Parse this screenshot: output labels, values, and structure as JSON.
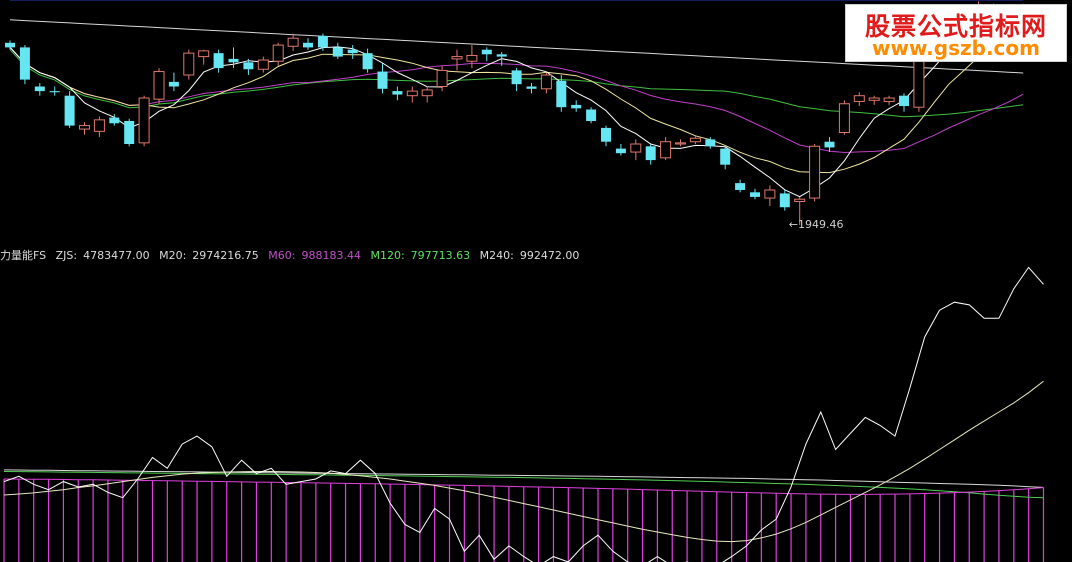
{
  "watermark": {
    "line1": "股票公式指标网",
    "line2": "www.gszb.com"
  },
  "colors": {
    "background": "#000000",
    "candle_up": "#e0786a",
    "candle_down": "#66e6f2",
    "ma_short": "#ffffff",
    "ma_mid": "#f0e6a0",
    "ma_purple": "#c040c8",
    "ma_green": "#40c040",
    "ma_long": "#d8d8d8",
    "ma_blue": "#2a3ab8",
    "fs_line": "#ffffff",
    "m20": "#e8e8c0",
    "m60": "#e040e0",
    "m120": "#50d050",
    "m240": "#d8d8d8",
    "m60_label": "#c050c8",
    "m120_label": "#60e060",
    "annotation": "#d0d0d0"
  },
  "legend": {
    "name": "力量能FS",
    "zjs_label": "ZJS:",
    "zjs_value": "4783477.00",
    "m20_label": "M20:",
    "m20_value": "2974216.75",
    "m60_label": "M60:",
    "m60_value": "988183.44",
    "m120_label": "M120:",
    "m120_value": "797713.63",
    "m240_label": "M240:",
    "m240_value": "992472.00"
  },
  "chart_data": [
    {
      "type": "candlestick",
      "annotation": "←1949.46",
      "low_marker": {
        "index": 52,
        "value": 1949.46
      },
      "ylim": [
        1940,
        2140
      ],
      "candles": [
        [
          2108,
          2110,
          2102,
          2104
        ],
        [
          2104,
          2106,
          2072,
          2076
        ],
        [
          2070,
          2073,
          2062,
          2066
        ],
        [
          2066,
          2070,
          2062,
          2065
        ],
        [
          2062,
          2066,
          2034,
          2036
        ],
        [
          2033,
          2039,
          2028,
          2036
        ],
        [
          2031,
          2044,
          2026,
          2041
        ],
        [
          2043,
          2046,
          2036,
          2038
        ],
        [
          2040,
          2042,
          2018,
          2020
        ],
        [
          2021,
          2062,
          2018,
          2060
        ],
        [
          2059,
          2086,
          2055,
          2083
        ],
        [
          2074,
          2082,
          2066,
          2070
        ],
        [
          2080,
          2102,
          2076,
          2099
        ],
        [
          2096,
          2102,
          2089,
          2101
        ],
        [
          2099,
          2102,
          2082,
          2086
        ],
        [
          2094,
          2104,
          2086,
          2091
        ],
        [
          2091,
          2094,
          2080,
          2085
        ],
        [
          2085,
          2096,
          2082,
          2093
        ],
        [
          2092,
          2108,
          2088,
          2106
        ],
        [
          2105,
          2116,
          2101,
          2112
        ],
        [
          2108,
          2112,
          2102,
          2104
        ],
        [
          2114,
          2116,
          2101,
          2104
        ],
        [
          2104,
          2108,
          2094,
          2096
        ],
        [
          2102,
          2106,
          2094,
          2099
        ],
        [
          2099,
          2103,
          2082,
          2085
        ],
        [
          2083,
          2090,
          2064,
          2068
        ],
        [
          2066,
          2070,
          2058,
          2063
        ],
        [
          2062,
          2070,
          2056,
          2066
        ],
        [
          2062,
          2070,
          2056,
          2067
        ],
        [
          2070,
          2088,
          2066,
          2084
        ],
        [
          2094,
          2102,
          2084,
          2096
        ],
        [
          2092,
          2106,
          2086,
          2097
        ],
        [
          2102,
          2104,
          2092,
          2098
        ],
        [
          2098,
          2100,
          2088,
          2096
        ],
        [
          2084,
          2086,
          2066,
          2072
        ],
        [
          2070,
          2073,
          2064,
          2068
        ],
        [
          2068,
          2082,
          2064,
          2080
        ],
        [
          2075,
          2080,
          2048,
          2052
        ],
        [
          2054,
          2058,
          2048,
          2051
        ],
        [
          2050,
          2052,
          2038,
          2040
        ],
        [
          2034,
          2036,
          2018,
          2022
        ],
        [
          2016,
          2020,
          2010,
          2012
        ],
        [
          2013,
          2024,
          2006,
          2020
        ],
        [
          2018,
          2020,
          2002,
          2006
        ],
        [
          2008,
          2026,
          2006,
          2022
        ],
        [
          2020,
          2024,
          2018,
          2021
        ],
        [
          2022,
          2027,
          2020,
          2025
        ],
        [
          2024,
          2026,
          2016,
          2018
        ],
        [
          2016,
          2018,
          1998,
          2002
        ],
        [
          1986,
          1989,
          1978,
          1980
        ],
        [
          1978,
          1981,
          1972,
          1974
        ],
        [
          1973,
          1984,
          1966,
          1980
        ],
        [
          1977,
          1980,
          1962,
          1965
        ],
        [
          1970,
          1974,
          1949.46,
          1972
        ],
        [
          1973,
          2020,
          1970,
          2018
        ],
        [
          2022,
          2026,
          2013,
          2017
        ],
        [
          2030,
          2058,
          2028,
          2055
        ],
        [
          2057,
          2065,
          2053,
          2062
        ],
        [
          2058,
          2062,
          2054,
          2060
        ],
        [
          2057,
          2062,
          2054,
          2060
        ],
        [
          2062,
          2064,
          2048,
          2053
        ],
        [
          2052,
          2130,
          2048,
          2128
        ],
        [
          2128,
          2136,
          2124,
          2132
        ],
        [
          2132,
          2138,
          2128,
          2134
        ],
        [
          2134,
          2140,
          2130,
          2136
        ],
        [
          2136,
          2144,
          2132,
          2138
        ],
        [
          2138,
          2142,
          2126,
          2128
        ],
        [
          2128,
          2138,
          2124,
          2134
        ],
        [
          2134,
          2142,
          2132,
          2140
        ]
      ]
    },
    {
      "type": "line",
      "title": "力量能FS",
      "ylim": [
        -400000,
        5200000
      ],
      "series": [
        {
          "name": "ZJS",
          "values": [
            1100000,
            1200000,
            1050000,
            950000,
            1100000,
            1000000,
            1050000,
            900000,
            800000,
            1150000,
            1550000,
            1350000,
            1800000,
            1950000,
            1750000,
            1200000,
            1500000,
            1250000,
            1350000,
            1050000,
            1100000,
            1150000,
            1300000,
            1250000,
            1500000,
            1250000,
            700000,
            300000,
            150000,
            600000,
            400000,
            -200000,
            100000,
            -350000,
            -100000,
            -300000,
            -500000,
            -300000,
            -400000,
            -100000,
            100000,
            -200000,
            -400000,
            -600000,
            -300000,
            -500000,
            -400000,
            -600000,
            -500000,
            -300000,
            -100000,
            200000,
            400000,
            1000000,
            1800000,
            2400000,
            1700000,
            2000000,
            2300000,
            2150000,
            1950000,
            2850000,
            3800000,
            4300000,
            4450000,
            4400000,
            4150000,
            4150000,
            4700000,
            5100000,
            4783477
          ]
        },
        {
          "name": "M20",
          "values": [
            850000,
            870000,
            890000,
            920000,
            950000,
            990000,
            1020000,
            1060000,
            1100000,
            1140000,
            1180000,
            1210000,
            1240000,
            1260000,
            1270000,
            1280000,
            1285000,
            1290000,
            1290000,
            1285000,
            1280000,
            1270000,
            1255000,
            1235000,
            1210000,
            1180000,
            1150000,
            1110000,
            1070000,
            1030000,
            980000,
            930000,
            870000,
            810000,
            750000,
            690000,
            630000,
            570000,
            510000,
            450000,
            390000,
            330000,
            270000,
            210000,
            160000,
            110000,
            60000,
            20000,
            -10000,
            -20000,
            0,
            50000,
            120000,
            220000,
            340000,
            480000,
            620000,
            760000,
            900000,
            1040000,
            1190000,
            1350000,
            1520000,
            1700000,
            1880000,
            2060000,
            2230000,
            2400000,
            2570000,
            2760000,
            2974216
          ]
        },
        {
          "name": "M60",
          "values": [
            1150000,
            1148000,
            1146000,
            1143000,
            1140000,
            1137000,
            1134000,
            1131000,
            1127000,
            1124000,
            1120000,
            1116000,
            1112000,
            1108000,
            1104000,
            1100000,
            1096000,
            1092000,
            1088000,
            1084000,
            1080000,
            1076000,
            1072000,
            1068000,
            1064000,
            1060000,
            1055000,
            1050000,
            1045000,
            1040000,
            1035000,
            1030000,
            1024000,
            1018000,
            1012000,
            1006000,
            1000000,
            994000,
            988000,
            981000,
            974000,
            967000,
            960000,
            952000,
            944000,
            936000,
            928000,
            920000,
            912000,
            904000,
            896000,
            889000,
            882000,
            876000,
            871000,
            867000,
            864000,
            862000,
            862000,
            864000,
            867000,
            872000,
            878000,
            886000,
            895000,
            905000,
            918000,
            932000,
            948000,
            966000,
            988183
          ]
        },
        {
          "name": "M120",
          "values": [
            1290000,
            1287000,
            1284000,
            1281000,
            1278000,
            1275000,
            1272000,
            1269000,
            1266000,
            1263000,
            1260000,
            1257000,
            1254000,
            1251000,
            1248000,
            1245000,
            1242000,
            1239000,
            1236000,
            1233000,
            1230000,
            1227000,
            1224000,
            1221000,
            1218000,
            1215000,
            1211000,
            1207000,
            1203000,
            1199000,
            1195000,
            1191000,
            1187000,
            1183000,
            1179000,
            1175000,
            1170000,
            1165000,
            1160000,
            1155000,
            1150000,
            1144000,
            1138000,
            1132000,
            1126000,
            1119000,
            1112000,
            1105000,
            1098000,
            1090000,
            1082000,
            1074000,
            1066000,
            1057000,
            1048000,
            1038000,
            1028000,
            1017000,
            1005000,
            992000,
            979000,
            964000,
            948000,
            931000,
            912000,
            891000,
            868000,
            846000,
            826000,
            810000,
            797713
          ]
        },
        {
          "name": "M240",
          "values": [
            1320000,
            1317000,
            1314000,
            1311000,
            1308000,
            1305000,
            1302000,
            1299000,
            1296000,
            1293000,
            1290000,
            1287000,
            1284000,
            1281000,
            1278000,
            1275000,
            1272000,
            1269000,
            1266000,
            1263000,
            1260000,
            1257000,
            1254000,
            1251000,
            1248000,
            1245000,
            1242000,
            1239000,
            1236000,
            1233000,
            1230000,
            1227000,
            1224000,
            1221000,
            1218000,
            1215000,
            1212000,
            1209000,
            1206000,
            1203000,
            1200000,
            1196000,
            1192000,
            1188000,
            1184000,
            1180000,
            1176000,
            1172000,
            1168000,
            1164000,
            1160000,
            1154000,
            1148000,
            1142000,
            1136000,
            1130000,
            1122000,
            1114000,
            1106000,
            1098000,
            1090000,
            1082000,
            1074000,
            1066000,
            1058000,
            1050000,
            1042000,
            1032000,
            1020000,
            1006000,
            992472
          ]
        }
      ]
    }
  ]
}
